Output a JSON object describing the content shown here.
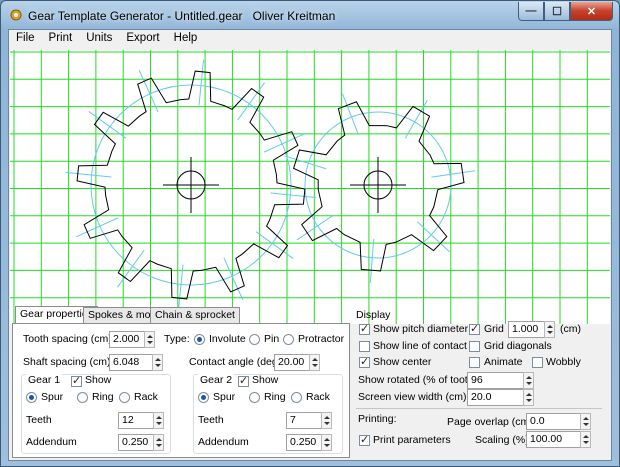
{
  "window": {
    "title": "Gear Template Generator - Untitled.gear",
    "author": "Oliver Kreitman",
    "minimize_glyph": "—",
    "maximize_glyph": "☐",
    "close_glyph": "✕"
  },
  "menu": [
    "File",
    "Print",
    "Units",
    "Export",
    "Help"
  ],
  "colors": {
    "grid": "#22dd22",
    "pitch_circle": "#66c8f0",
    "gear_outline": "#000000"
  },
  "gears_view": {
    "gear1_teeth": 12,
    "gear2_teeth": 7
  },
  "tabs": [
    "Gear properties",
    "Spokes & more",
    "Chain & sprocket"
  ],
  "gear_properties": {
    "tooth_spacing_label": "Tooth spacing (cm)",
    "tooth_spacing": "2.000",
    "type_label": "Type:",
    "type_options": [
      "Involute",
      "Pin",
      "Protractor"
    ],
    "shaft_spacing_label": "Shaft spacing (cm)",
    "shaft_spacing": "6.048",
    "contact_angle_label": "Contact angle (deg)",
    "contact_angle": "20.00",
    "gear1": {
      "title": "Gear 1",
      "show": "Show",
      "kind_options": [
        "Spur",
        "Ring",
        "Rack"
      ],
      "teeth_label": "Teeth",
      "teeth": "12",
      "addendum_label": "Addendum",
      "addendum": "0.250"
    },
    "gear2": {
      "title": "Gear 2",
      "show": "Show",
      "kind_options": [
        "Spur",
        "Ring",
        "Rack"
      ],
      "teeth_label": "Teeth",
      "teeth": "7",
      "addendum_label": "Addendum",
      "addendum": "0.250"
    }
  },
  "display": {
    "title": "Display",
    "show_pitch_diameter": "Show pitch diameter",
    "show_line_of_contact": "Show line of contact",
    "show_center": "Show center",
    "grid": "Grid",
    "grid_value": "1.000",
    "grid_unit": "(cm)",
    "grid_diagonals": "Grid diagonals",
    "animate": "Animate",
    "wobbly": "Wobbly",
    "show_rotated_label": "Show rotated (% of tooth)",
    "show_rotated": "96",
    "screen_view_width_label": "Screen view width (cm)",
    "screen_view_width": "20.0"
  },
  "printing": {
    "title": "Printing:",
    "page_overlap_label": "Page overlap (cm)",
    "page_overlap": "0.0",
    "print_parameters": "Print parameters",
    "scaling_label": "Scaling (%)",
    "scaling": "100.00"
  }
}
